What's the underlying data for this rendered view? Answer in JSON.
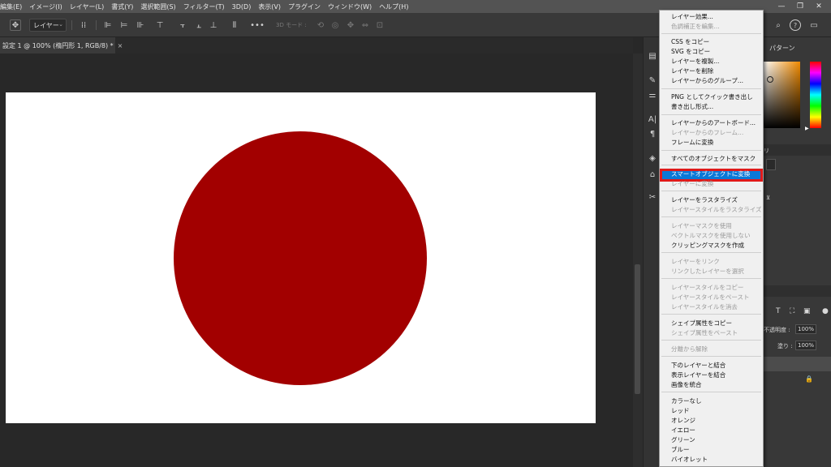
{
  "menubar": {
    "items": [
      "編集(E)",
      "イメージ(I)",
      "レイヤー(L)",
      "書式(Y)",
      "選択範囲(S)",
      "フィルター(T)",
      "3D(D)",
      "表示(V)",
      "プラグイン",
      "ウィンドウ(W)",
      "ヘルプ(H)"
    ]
  },
  "options": {
    "layer_select": "レイヤー",
    "mode3d": "3D モード :"
  },
  "tab": {
    "title": "設定 1 @ 100% (楕円形 1, RGB/8) *",
    "close": "×"
  },
  "canvas": {
    "circle_color": "#a20000",
    "background": "#ffffff"
  },
  "panels": {
    "pattern_tab": "パターン",
    "opacity_label": "不透明度 :",
    "opacity_value": "100%",
    "fill_label": "塗り :",
    "fill_value": "100%",
    "tab_fragment": "リ"
  },
  "context_menu": {
    "items": [
      {
        "label": "レイヤー効果...",
        "disabled": false
      },
      {
        "label": "色調補正を編集...",
        "disabled": true
      },
      {
        "label": "CSS をコピー",
        "disabled": false
      },
      {
        "label": "SVG をコピー",
        "disabled": false
      },
      {
        "label": "レイヤーを複製...",
        "disabled": false
      },
      {
        "label": "レイヤーを削除",
        "disabled": false
      },
      {
        "label": "レイヤーからのグループ...",
        "disabled": false
      },
      {
        "label": "PNG としてクイック書き出し",
        "disabled": false
      },
      {
        "label": "書き出し形式...",
        "disabled": false
      },
      {
        "label": "レイヤーからのアートボード...",
        "disabled": false
      },
      {
        "label": "レイヤーからのフレーム...",
        "disabled": true
      },
      {
        "label": "フレームに変換",
        "disabled": false
      },
      {
        "label": "すべてのオブジェクトをマスク",
        "disabled": false
      },
      {
        "label": "スマートオブジェクトに変換",
        "disabled": false,
        "selected": true
      },
      {
        "label": "レイヤーに変換",
        "disabled": true
      },
      {
        "label": "レイヤーをラスタライズ",
        "disabled": false
      },
      {
        "label": "レイヤースタイルをラスタライズ",
        "disabled": true
      },
      {
        "label": "レイヤーマスクを使用",
        "disabled": true
      },
      {
        "label": "ベクトルマスクを使用しない",
        "disabled": true
      },
      {
        "label": "クリッピングマスクを作成",
        "disabled": false
      },
      {
        "label": "レイヤーをリンク",
        "disabled": true
      },
      {
        "label": "リンクしたレイヤーを選択",
        "disabled": true
      },
      {
        "label": "レイヤースタイルをコピー",
        "disabled": true
      },
      {
        "label": "レイヤースタイルをペースト",
        "disabled": true
      },
      {
        "label": "レイヤースタイルを消去",
        "disabled": true
      },
      {
        "label": "シェイプ属性をコピー",
        "disabled": false
      },
      {
        "label": "シェイプ属性をペースト",
        "disabled": true
      },
      {
        "label": "分離から解除",
        "disabled": true
      },
      {
        "label": "下のレイヤーと結合",
        "disabled": false
      },
      {
        "label": "表示レイヤーを結合",
        "disabled": false
      },
      {
        "label": "画像を統合",
        "disabled": false
      },
      {
        "label": "カラーなし",
        "disabled": false
      },
      {
        "label": "レッド",
        "disabled": false
      },
      {
        "label": "オレンジ",
        "disabled": false
      },
      {
        "label": "イエロー",
        "disabled": false
      },
      {
        "label": "グリーン",
        "disabled": false
      },
      {
        "label": "ブルー",
        "disabled": false
      },
      {
        "label": "バイオレット",
        "disabled": false
      }
    ]
  },
  "colors": {
    "highlight": "#0a78d7",
    "annotation_box": "#e01a1a"
  }
}
